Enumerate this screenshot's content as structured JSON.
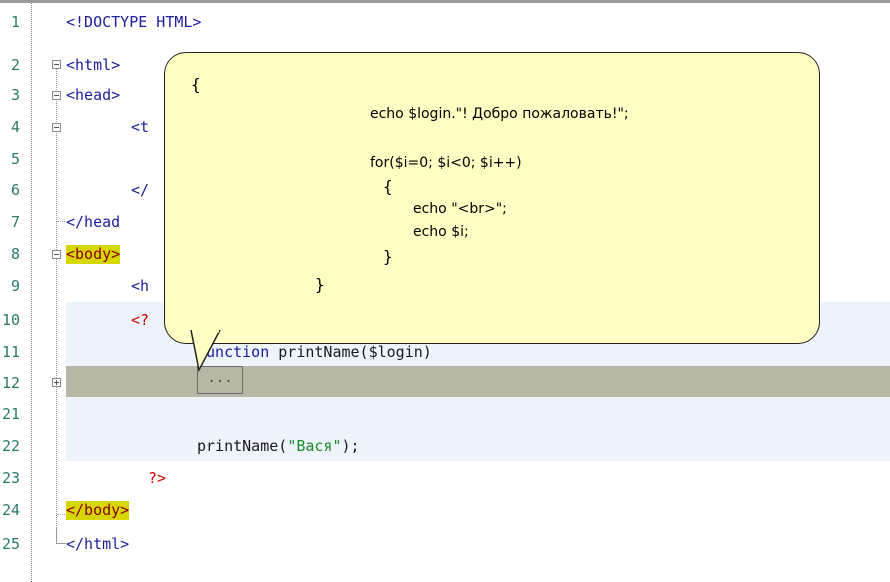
{
  "editor": {
    "line_numbers": [
      "1",
      "2",
      "3",
      "4",
      "5",
      "6",
      "7",
      "8",
      "9",
      "10",
      "11",
      "12",
      "21",
      "22",
      "23",
      "24",
      "25"
    ],
    "lines": {
      "l1": "<!DOCTYPE HTML>",
      "l2": "<html>",
      "l3": "<head>",
      "l4": "<t",
      "l6": "</",
      "l7": "</head",
      "l8": "<body>",
      "l9": "<h",
      "l10": "<?",
      "l11_kw": "function",
      "l11_rest": " printName($login)",
      "l12_collapsed": "...",
      "l22_fn": "printName(",
      "l22_str": "\"Вася\"",
      "l22_end": ");",
      "l23": "?>",
      "l24": "</body>",
      "l25": "</html>"
    }
  },
  "tooltip": {
    "open_brace": "{",
    "echo_login": "echo $login.\"! Добро пожаловать!\";",
    "for_loop": "for($i=0; $i<0; $i++)",
    "inner_open": "{",
    "echo_br": "echo \"<br>\";",
    "echo_i": "echo $i;",
    "inner_close": "}",
    "close_brace": "}"
  },
  "colors": {
    "line_number": "#2a7a6a",
    "tag": "#1c1c9e",
    "string": "#1e8a2a",
    "php_delim": "#d40000",
    "tooltip_bg": "#ffffc4",
    "collapsed_row": "#b8b6a4",
    "highlight": "#d6d600"
  }
}
